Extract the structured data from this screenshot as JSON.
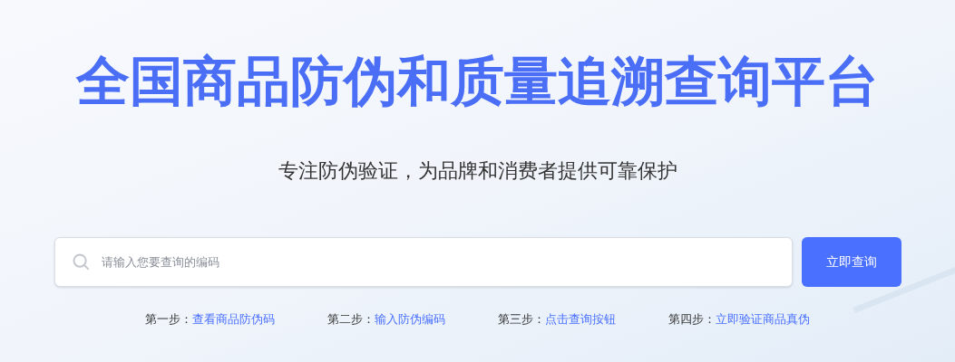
{
  "title": "全国商品防伪和质量追溯查询平台",
  "subtitle": "专注防伪验证，为品牌和消费者提供可靠保护",
  "search": {
    "placeholder": "请输入您要查询的编码"
  },
  "search_button": "立即查询",
  "steps": [
    {
      "label": "第一步：",
      "action": "查看商品防伪码"
    },
    {
      "label": "第二步：",
      "action": "输入防伪编码"
    },
    {
      "label": "第三步：",
      "action": "点击查询按钮"
    },
    {
      "label": "第四步：",
      "action": "立即验证商品真伪"
    }
  ]
}
